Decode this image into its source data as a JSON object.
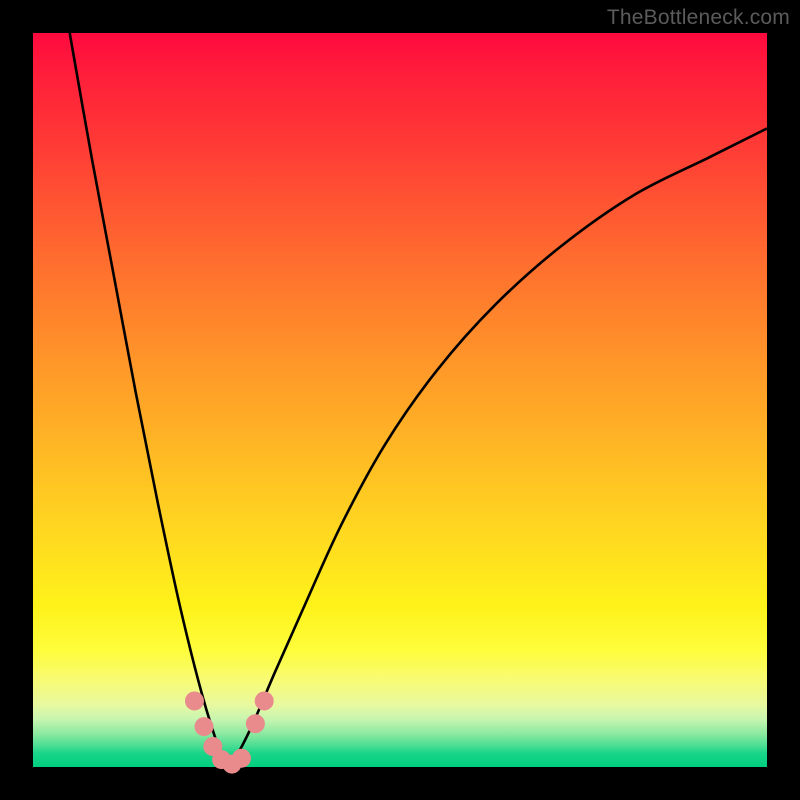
{
  "watermark": "TheBottleneck.com",
  "chart_data": {
    "type": "line",
    "title": "",
    "xlabel": "",
    "ylabel": "",
    "xlim": [
      0,
      100
    ],
    "ylim": [
      0,
      100
    ],
    "grid": false,
    "legend": false,
    "note": "Axes unlabeled; values estimated from pixel positions on a 0–100 normalized scale. Background gradient encodes red (top) → green (bottom). Bottleneck-style V-curve with minimum near x≈26 touching y≈0.",
    "series": [
      {
        "name": "left-branch",
        "x": [
          5,
          8,
          11,
          14,
          17,
          20,
          23,
          25.5,
          26.5
        ],
        "y": [
          100,
          83,
          67,
          51,
          36,
          22,
          10,
          2,
          0
        ]
      },
      {
        "name": "right-branch",
        "x": [
          26.5,
          28,
          30,
          33,
          37,
          42,
          48,
          55,
          63,
          72,
          82,
          92,
          100
        ],
        "y": [
          0,
          2,
          6,
          13,
          22,
          33,
          44,
          54,
          63,
          71,
          78,
          83,
          87
        ]
      }
    ],
    "markers": {
      "name": "highlight-dots",
      "color": "#e98b8d",
      "points": [
        {
          "x": 22.0,
          "y": 9.0
        },
        {
          "x": 23.3,
          "y": 5.5
        },
        {
          "x": 24.5,
          "y": 2.8
        },
        {
          "x": 25.7,
          "y": 1.0
        },
        {
          "x": 27.1,
          "y": 0.4
        },
        {
          "x": 28.4,
          "y": 1.2
        },
        {
          "x": 30.3,
          "y": 5.9
        },
        {
          "x": 31.5,
          "y": 9.0
        }
      ]
    }
  }
}
